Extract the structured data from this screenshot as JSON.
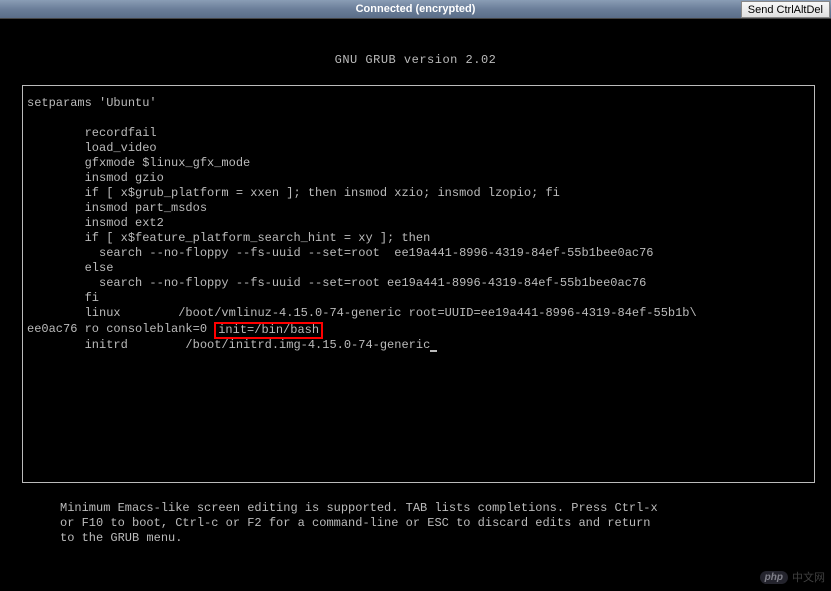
{
  "titlebar": {
    "status": "Connected (encrypted)",
    "send_button": "Send CtrlAltDel"
  },
  "grub": {
    "header": "GNU GRUB  version 2.02",
    "editor_lines": {
      "l1": "setparams 'Ubuntu'",
      "l2": "",
      "l3": "        recordfail",
      "l4": "        load_video",
      "l5": "        gfxmode $linux_gfx_mode",
      "l6": "        insmod gzio",
      "l7": "        if [ x$grub_platform = xxen ]; then insmod xzio; insmod lzopio; fi",
      "l8": "        insmod part_msdos",
      "l9": "        insmod ext2",
      "l10": "        if [ x$feature_platform_search_hint = xy ]; then",
      "l11": "          search --no-floppy --fs-uuid --set=root  ee19a441-8996-4319-84ef-55b1bee0ac76",
      "l12": "        else",
      "l13": "          search --no-floppy --fs-uuid --set=root ee19a441-8996-4319-84ef-55b1bee0ac76",
      "l14": "        fi",
      "l15a": "        linux        /boot/vmlinuz-4.15.0-74-generic root=UUID=ee19a441-8996-4319-84ef-55b1b\\",
      "l16a": "ee0ac76 ro consoleblank=0 ",
      "l16_highlight": "init=/bin/bash",
      "l17": "        initrd        /boot/initrd.img-4.15.0-74-generic"
    },
    "help": "Minimum Emacs-like screen editing is supported. TAB lists completions. Press Ctrl-x\nor F10 to boot, Ctrl-c or F2 for a command-line or ESC to discard edits and return\nto the GRUB menu."
  },
  "watermark": {
    "badge": "php",
    "text": "中文网"
  }
}
